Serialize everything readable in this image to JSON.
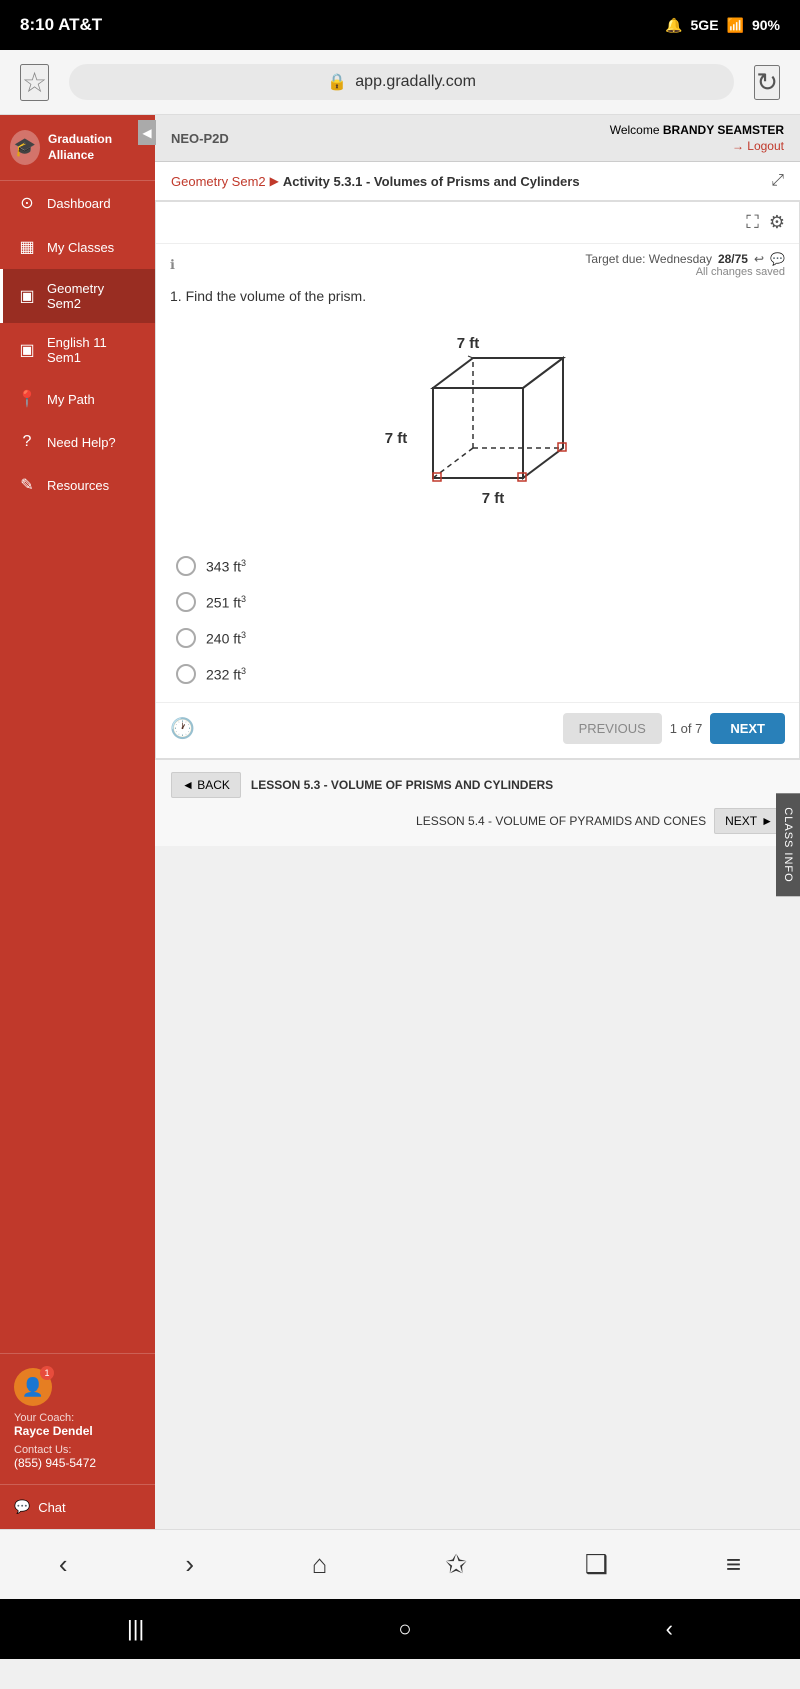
{
  "statusBar": {
    "time": "8:10 AT&T",
    "icons": "🔔 5GE",
    "battery": "90%"
  },
  "browserBar": {
    "url": "app.gradally.com",
    "starIcon": "☆",
    "refreshIcon": "↻",
    "lockIcon": "🔒"
  },
  "sidebar": {
    "logo": {
      "name": "Graduation Alliance",
      "icon": "🎓"
    },
    "navItems": [
      {
        "id": "dashboard",
        "label": "Dashboard",
        "icon": "⊙"
      },
      {
        "id": "my-classes",
        "label": "My Classes",
        "icon": "▦"
      },
      {
        "id": "geometry-sem2",
        "label": "Geometry Sem2",
        "icon": "▣",
        "active": true
      },
      {
        "id": "english-sem1",
        "label": "English 11 Sem1",
        "icon": "▣"
      },
      {
        "id": "my-path",
        "label": "My Path",
        "icon": "📍"
      },
      {
        "id": "need-help",
        "label": "Need Help?",
        "icon": "?"
      },
      {
        "id": "resources",
        "label": "Resources",
        "icon": "✎"
      }
    ],
    "coach": {
      "label": "Your Coach:",
      "name": "Rayce Dendel",
      "avatar": "👤",
      "badgeCount": "1"
    },
    "contact": {
      "label": "Contact Us:",
      "phone": "(855) 945-5472"
    },
    "chat": {
      "label": "Chat",
      "icon": "💬"
    }
  },
  "topBar": {
    "neoLabel": "NEO-P2D",
    "welcomeText": "Welcome",
    "userName": "BRANDY SEAMSTER",
    "logoutLabel": "→ Logout"
  },
  "breadcrumb": {
    "parent": "Geometry Sem2",
    "separator": "▶",
    "current": "Activity 5.3.1 - Volumes of Prisms and Cylinders",
    "expandIcon": "⤢"
  },
  "activity": {
    "targetDue": "Target due: Wednesday",
    "score": "28/75",
    "changesSaved": "All changes saved",
    "questionNumber": "1.",
    "questionText": "Find the volume of the prism.",
    "prism": {
      "dimension1": "7 ft",
      "dimension2": "7 ft",
      "dimension3": "7 ft"
    },
    "answers": [
      {
        "id": "a",
        "value": "343 ft",
        "superscript": "3"
      },
      {
        "id": "b",
        "value": "251 ft",
        "superscript": "3"
      },
      {
        "id": "c",
        "value": "240 ft",
        "superscript": "3"
      },
      {
        "id": "d",
        "value": "232 ft",
        "superscript": "3"
      }
    ],
    "pagination": {
      "current": "1",
      "total": "7",
      "separator": "of"
    },
    "buttons": {
      "previous": "PREVIOUS",
      "next": "NEXT"
    }
  },
  "lessonNav": {
    "backLabel": "◄ BACK",
    "currentLesson": "LESSON 5.3 - VOLUME OF PRISMS AND CYLINDERS",
    "nextLessonLabel": "LESSON 5.4 - VOLUME OF PYRAMIDS AND CONES",
    "nextBtnLabel": "NEXT",
    "nextIcon": "►"
  },
  "classInfoTab": "CLASS INFO",
  "bottomNav": {
    "buttons": [
      "‹",
      "›",
      "⌂",
      "✩",
      "❑",
      "≡"
    ]
  },
  "androidNav": {
    "buttons": [
      "|||",
      "○",
      "‹"
    ]
  }
}
